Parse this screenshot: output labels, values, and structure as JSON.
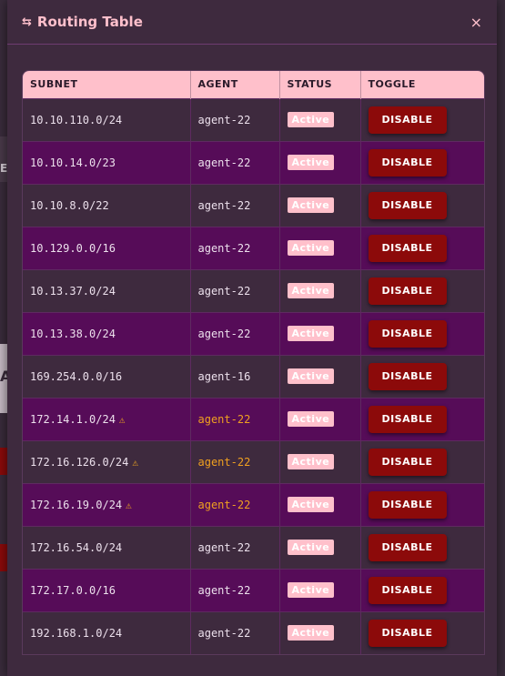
{
  "modal": {
    "title": "Routing Table",
    "title_icon": "⇆",
    "close_label": "×"
  },
  "table": {
    "headers": [
      "SUBNET",
      "AGENT",
      "STATUS",
      "TOGGLE"
    ],
    "rows": [
      {
        "subnet": "10.10.110.0/24",
        "agent": "agent-22",
        "status": "Active",
        "toggle": "DISABLE",
        "warning": false
      },
      {
        "subnet": "10.10.14.0/23",
        "agent": "agent-22",
        "status": "Active",
        "toggle": "DISABLE",
        "warning": false
      },
      {
        "subnet": "10.10.8.0/22",
        "agent": "agent-22",
        "status": "Active",
        "toggle": "DISABLE",
        "warning": false
      },
      {
        "subnet": "10.129.0.0/16",
        "agent": "agent-22",
        "status": "Active",
        "toggle": "DISABLE",
        "warning": false
      },
      {
        "subnet": "10.13.37.0/24",
        "agent": "agent-22",
        "status": "Active",
        "toggle": "DISABLE",
        "warning": false
      },
      {
        "subnet": "10.13.38.0/24",
        "agent": "agent-22",
        "status": "Active",
        "toggle": "DISABLE",
        "warning": false
      },
      {
        "subnet": "169.254.0.0/16",
        "agent": "agent-16",
        "status": "Active",
        "toggle": "DISABLE",
        "warning": false
      },
      {
        "subnet": "172.14.1.0/24",
        "agent": "agent-22",
        "status": "Active",
        "toggle": "DISABLE",
        "warning": true
      },
      {
        "subnet": "172.16.126.0/24",
        "agent": "agent-22",
        "status": "Active",
        "toggle": "DISABLE",
        "warning": true
      },
      {
        "subnet": "172.16.19.0/24",
        "agent": "agent-22",
        "status": "Active",
        "toggle": "DISABLE",
        "warning": true
      },
      {
        "subnet": "172.16.54.0/24",
        "agent": "agent-22",
        "status": "Active",
        "toggle": "DISABLE",
        "warning": false
      },
      {
        "subnet": "172.17.0.0/16",
        "agent": "agent-22",
        "status": "Active",
        "toggle": "DISABLE",
        "warning": false
      },
      {
        "subnet": "192.168.1.0/24",
        "agent": "agent-22",
        "status": "Active",
        "toggle": "DISABLE",
        "warning": false
      }
    ]
  },
  "warning_icon": "⚠",
  "background": {
    "letters": [
      "E",
      "A"
    ]
  },
  "colors": {
    "header_bg": "#ffc0cb",
    "accent_pink": "#ffc0cc",
    "disable_button": "#8c0a0a",
    "warning": "#f0a020",
    "row_alt": "#560c58"
  }
}
